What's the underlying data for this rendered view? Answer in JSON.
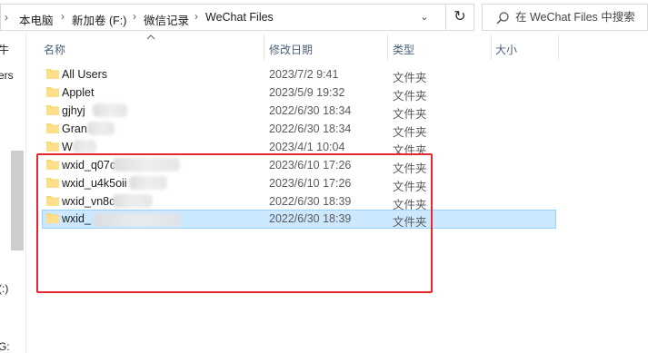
{
  "address_bar": {
    "crumbs": [
      "本电脑",
      "新加卷 (F:)",
      "微信记录",
      "WeChat Files"
    ]
  },
  "search": {
    "placeholder": "在 WeChat Files 中搜索"
  },
  "nav_pane": {
    "fragments": [
      "牛",
      "ers",
      "(:)",
      "G:"
    ]
  },
  "columns": {
    "name": "名称",
    "date": "修改日期",
    "type": "类型",
    "size": "大小"
  },
  "rows": [
    {
      "name": "All Users",
      "date": "2023/7/2 9:41",
      "type": "文件夹"
    },
    {
      "name": "Applet",
      "date": "2023/5/9 19:32",
      "type": "文件夹"
    },
    {
      "name": "gjhyj",
      "date": "2022/6/30 18:34",
      "type": "文件夹"
    },
    {
      "name": "Gran",
      "date": "2022/6/30 18:34",
      "type": "文件夹"
    },
    {
      "name": "W",
      "date": "2023/4/1 10:04",
      "type": "文件夹"
    },
    {
      "name": "wxid_q07c",
      "date": "2023/6/10 17:26",
      "type": "文件夹"
    },
    {
      "name": "wxid_u4k5oii",
      "date": "2023/6/10 17:26",
      "type": "文件夹"
    },
    {
      "name": "wxid_vn8c",
      "date": "2022/6/30 18:39",
      "type": "文件夹"
    },
    {
      "name": "wxid_",
      "date": "2022/6/30 18:39",
      "type": "文件夹"
    }
  ],
  "selected_row_index": 8,
  "colors": {
    "selection_bg": "#cce8ff",
    "selection_border": "#99d1ff",
    "highlight_box": "#e8262d",
    "folder": "#f8d775",
    "header_text": "#4c607a"
  }
}
